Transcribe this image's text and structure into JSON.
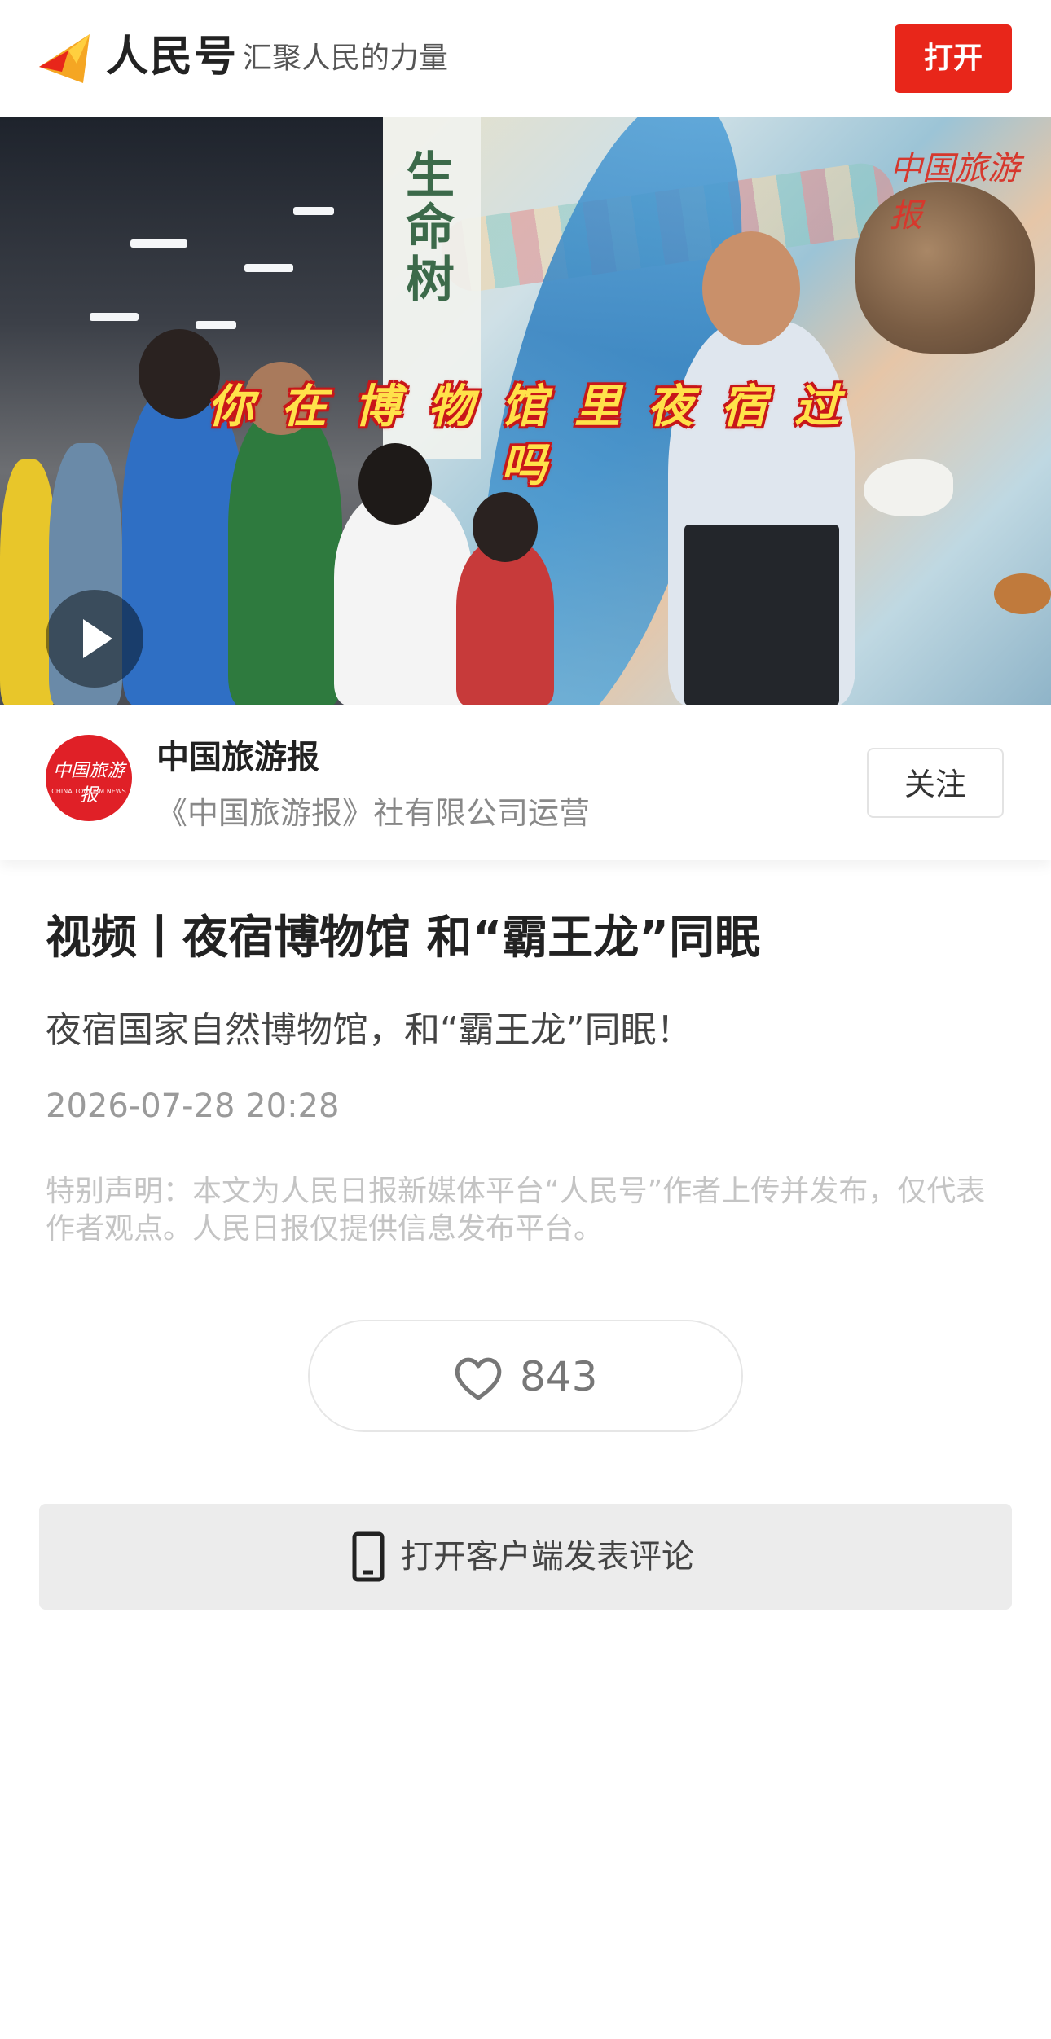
{
  "header": {
    "brand_name": "人民号",
    "slogan": "汇聚人民的力量",
    "open_button": "打开"
  },
  "video": {
    "caption": "你在博物馆里夜宿过吗",
    "exhibit_sign": "生命树",
    "watermark": "中国旅游报"
  },
  "author": {
    "name": "中国旅游报",
    "description": "《中国旅游报》社有限公司运营",
    "avatar_text": "中国旅游报",
    "avatar_subtext": "CHINA TOURISM NEWS",
    "follow_button": "关注"
  },
  "article": {
    "title": "视频丨夜宿博物馆 和“霸王龙”同眠",
    "summary": "夜宿国家自然博物馆，和“霸王龙”同眠！",
    "timestamp": "2026-07-28 20:28",
    "disclaimer": "特别声明：本文为人民日报新媒体平台“人民号”作者上传并发布，仅代表作者观点。人民日报仅提供信息发布平台。"
  },
  "like": {
    "count": "843",
    "icon": "heart-icon"
  },
  "comment": {
    "label": "打开客户端发表评论",
    "icon": "phone-icon"
  },
  "colors": {
    "accent": "#e8261a",
    "caption_fill": "#ffe24a",
    "caption_outline": "#c8171a"
  }
}
